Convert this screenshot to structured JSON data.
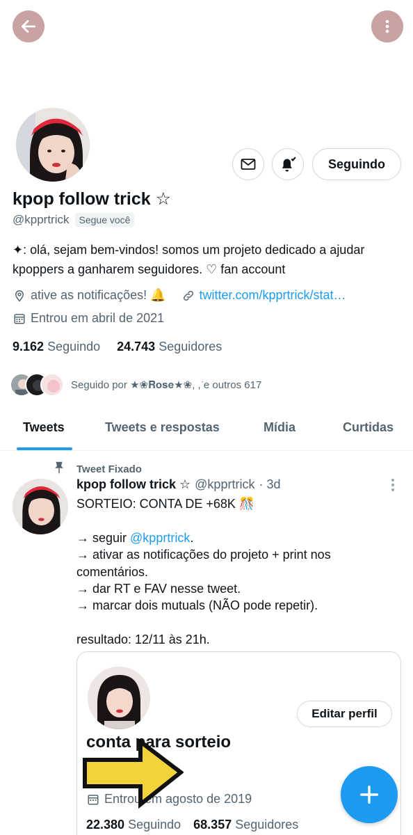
{
  "header": {
    "back_icon": "arrow-left-icon",
    "more_icon": "more-vertical-icon",
    "button_color": "#c9a2a2"
  },
  "profile": {
    "display_name": "kpop follow trick ☆",
    "handle": "@kpprtrick",
    "follows_you": "Segue você",
    "bio": "✦: olá, sejam bem-vindos! somos um projeto dedicado a ajudar kpoppers a ganharem seguidores. ♡ fan account",
    "location": "ative as notificações! 🔔",
    "website": "twitter.com/kpprtrick/stat…",
    "joined": "Entrou em abril de 2021",
    "following_count": "9.162",
    "following_label": "Seguindo",
    "followers_count": "24.743",
    "followers_label": "Seguidores",
    "followed_by": "Seguido por ★❀𝐑𝐨𝐬𝐞★❀, ,͘ e outros 617",
    "following_button": "Seguindo"
  },
  "tabs": [
    {
      "label": "Tweets",
      "active": true
    },
    {
      "label": "Tweets e respostas",
      "active": false
    },
    {
      "label": "Mídia",
      "active": false
    },
    {
      "label": "Curtidas",
      "active": false
    }
  ],
  "pinned_tweet": {
    "pinned_label": "Tweet Fixado",
    "author_name": "kpop follow trick ☆",
    "author_handle": "@kpprtrick",
    "time": "· 3d",
    "lines": [
      "SORTEIO: CONTA DE +68K 🎊",
      "",
      "→ seguir ",
      "→ ativar as notificações do projeto + print nos",
      "comentários.",
      "→ dar RT e FAV nesse tweet.",
      "→ marcar dois mutuals (NÃO pode repetir).",
      "",
      "resultado: 12/11 às 21h."
    ],
    "mention": "@kpprtrick",
    "mention_suffix": "."
  },
  "embedded_card": {
    "edit_profile_button": "Editar perfil",
    "name": "conta para sorteio",
    "joined": "Entrou em agosto de 2019",
    "following_count": "22.380",
    "following_label": "Seguindo",
    "followers_count": "68.357",
    "followers_label": "Seguidores"
  },
  "colors": {
    "accent": "#1d9bf0",
    "arrow_yellow": "#f2d43a"
  },
  "fab": {
    "icon": "plus-icon"
  }
}
